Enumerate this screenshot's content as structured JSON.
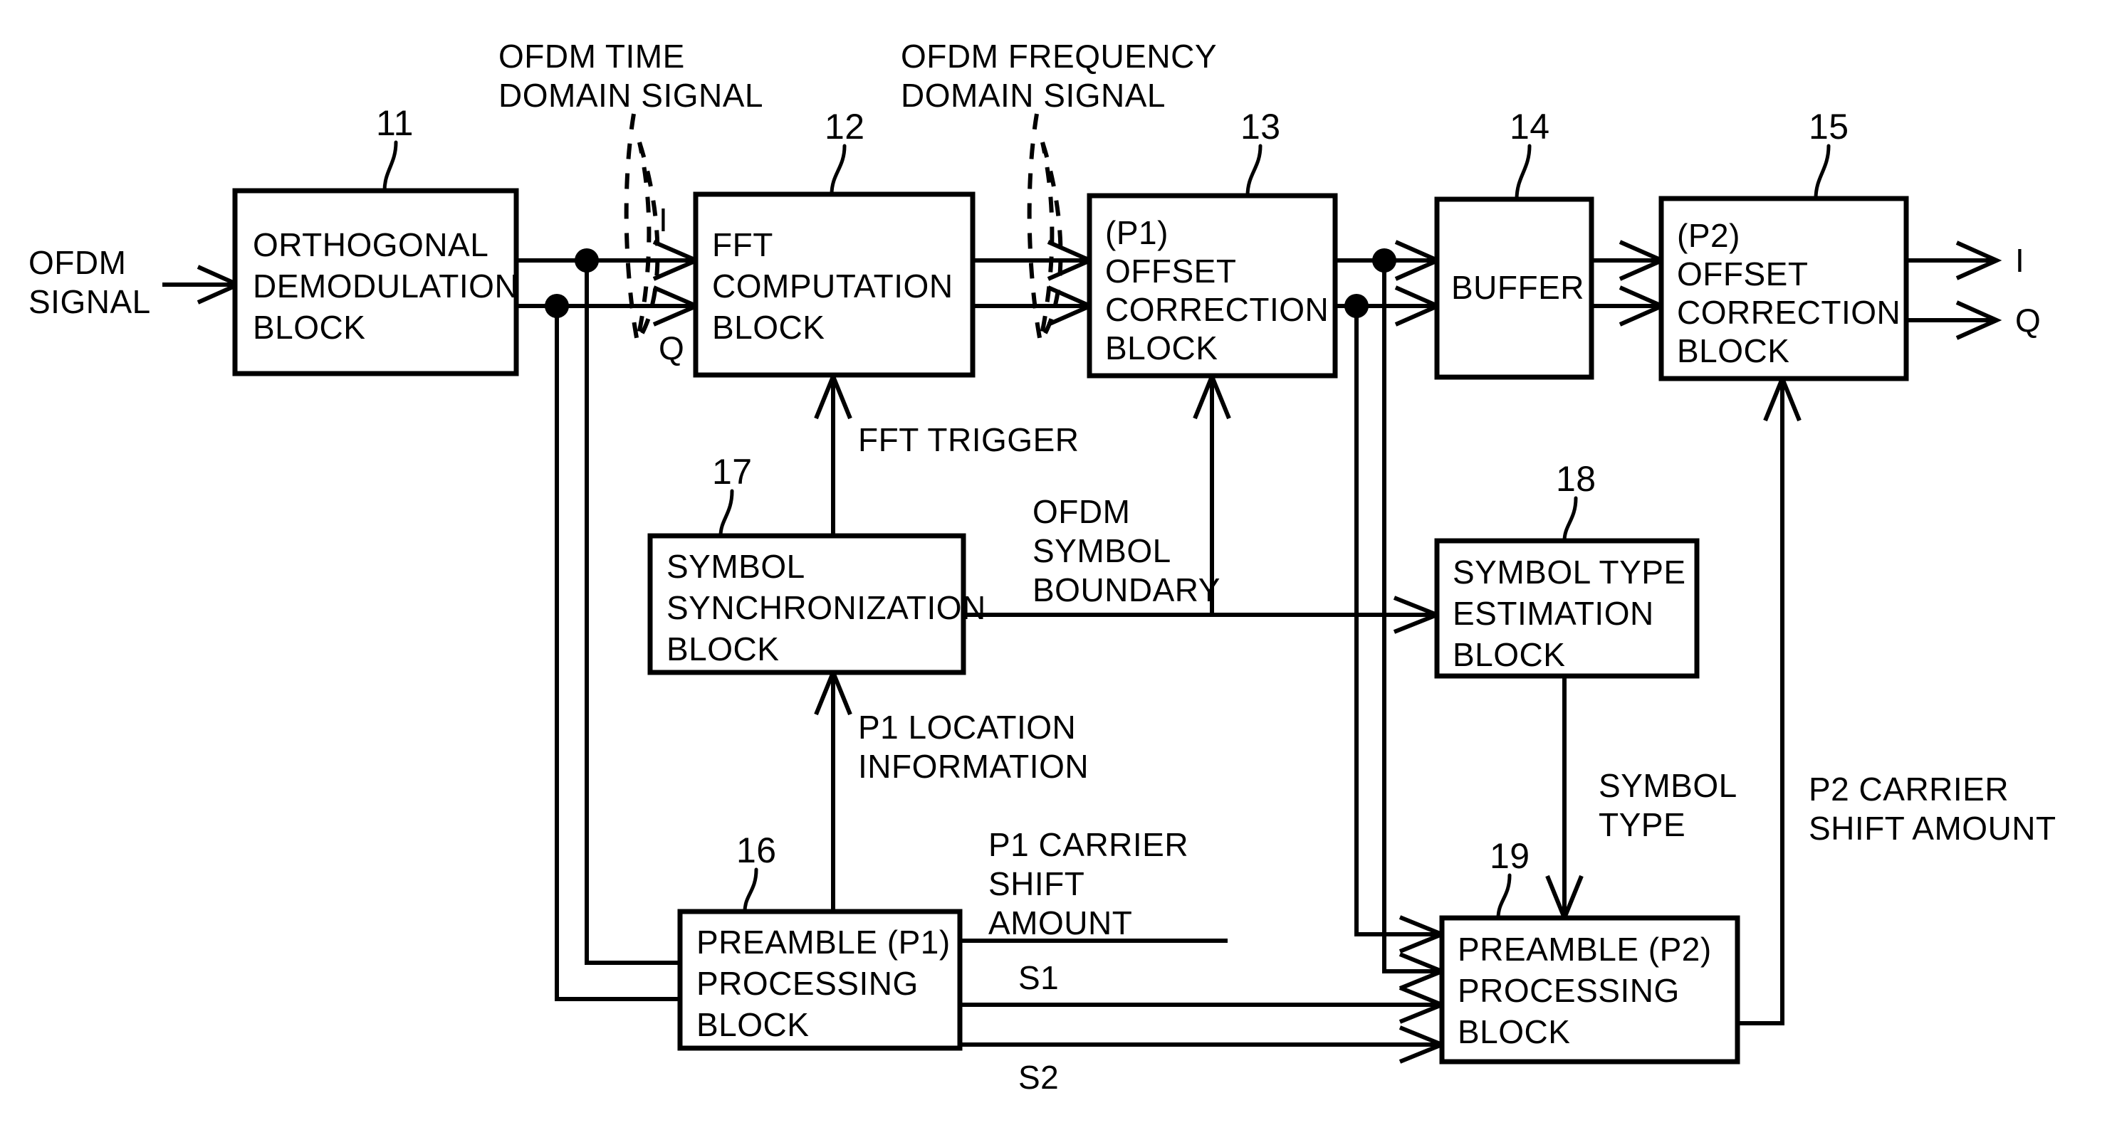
{
  "figure": {
    "type": "block-diagram",
    "description": "OFDM receiver block diagram with preamble P1/P2 processing"
  },
  "blocks": [
    {
      "id": "11",
      "ref": "11",
      "lines": [
        "ORTHOGONAL",
        "DEMODULATION",
        "BLOCK"
      ]
    },
    {
      "id": "12",
      "ref": "12",
      "lines": [
        "FFT",
        "COMPUTATION",
        "BLOCK"
      ]
    },
    {
      "id": "13",
      "ref": "13",
      "lines": [
        "(P1)",
        "OFFSET",
        "CORRECTION",
        "BLOCK"
      ]
    },
    {
      "id": "14",
      "ref": "14",
      "lines": [
        "BUFFER"
      ]
    },
    {
      "id": "15",
      "ref": "15",
      "lines": [
        "(P2)",
        "OFFSET",
        "CORRECTION",
        "BLOCK"
      ]
    },
    {
      "id": "16",
      "ref": "16",
      "lines": [
        "PREAMBLE (P1)",
        "PROCESSING",
        "BLOCK"
      ]
    },
    {
      "id": "17",
      "ref": "17",
      "lines": [
        "SYMBOL",
        "SYNCHRONIZATION",
        "BLOCK"
      ]
    },
    {
      "id": "18",
      "ref": "18",
      "lines": [
        "SYMBOL TYPE",
        "ESTIMATION",
        "BLOCK"
      ]
    },
    {
      "id": "19",
      "ref": "19",
      "lines": [
        "PREAMBLE (P2)",
        "PROCESSING",
        "BLOCK"
      ]
    }
  ],
  "labels": {
    "input_signal_l1": "OFDM",
    "input_signal_l2": "SIGNAL",
    "time_domain_l1": "OFDM TIME",
    "time_domain_l2": "DOMAIN SIGNAL",
    "freq_domain_l1": "OFDM FREQUENCY",
    "freq_domain_l2": "DOMAIN SIGNAL",
    "in_I": "I",
    "in_Q": "Q",
    "out_I": "I",
    "out_Q": "Q",
    "fft_trigger": "FFT TRIGGER",
    "symbol_boundary_l1": "OFDM",
    "symbol_boundary_l2": "SYMBOL",
    "symbol_boundary_l3": "BOUNDARY",
    "p1_location_l1": "P1 LOCATION",
    "p1_location_l2": "INFORMATION",
    "p1_carrier_l1": "P1 CARRIER",
    "p1_carrier_l2": "SHIFT",
    "p1_carrier_l3": "AMOUNT",
    "s1": "S1",
    "s2": "S2",
    "symbol_type_l1": "SYMBOL",
    "symbol_type_l2": "TYPE",
    "p2_carrier_l1": "P2 CARRIER",
    "p2_carrier_l2": "SHIFT AMOUNT"
  },
  "refs": {
    "r11": "11",
    "r12": "12",
    "r13": "13",
    "r14": "14",
    "r15": "15",
    "r16": "16",
    "r17": "17",
    "r18": "18",
    "r19": "19"
  },
  "block_text": {
    "b11_l1": "ORTHOGONAL",
    "b11_l2": "DEMODULATION",
    "b11_l3": "BLOCK",
    "b12_l1": "FFT",
    "b12_l2": "COMPUTATION",
    "b12_l3": "BLOCK",
    "b13_l1": "(P1)",
    "b13_l2": "OFFSET",
    "b13_l3": "CORRECTION",
    "b13_l4": "BLOCK",
    "b14_l1": "BUFFER",
    "b15_l1": "(P2)",
    "b15_l2": "OFFSET",
    "b15_l3": "CORRECTION",
    "b15_l4": "BLOCK",
    "b16_l1": "PREAMBLE (P1)",
    "b16_l2": "PROCESSING",
    "b16_l3": "BLOCK",
    "b17_l1": "SYMBOL",
    "b17_l2": "SYNCHRONIZATION",
    "b17_l3": "BLOCK",
    "b18_l1": "SYMBOL TYPE",
    "b18_l2": "ESTIMATION",
    "b18_l3": "BLOCK",
    "b19_l1": "PREAMBLE (P2)",
    "b19_l2": "PROCESSING",
    "b19_l3": "BLOCK"
  },
  "colors": {
    "line": "#000000",
    "background": "#ffffff",
    "text": "#000000"
  }
}
